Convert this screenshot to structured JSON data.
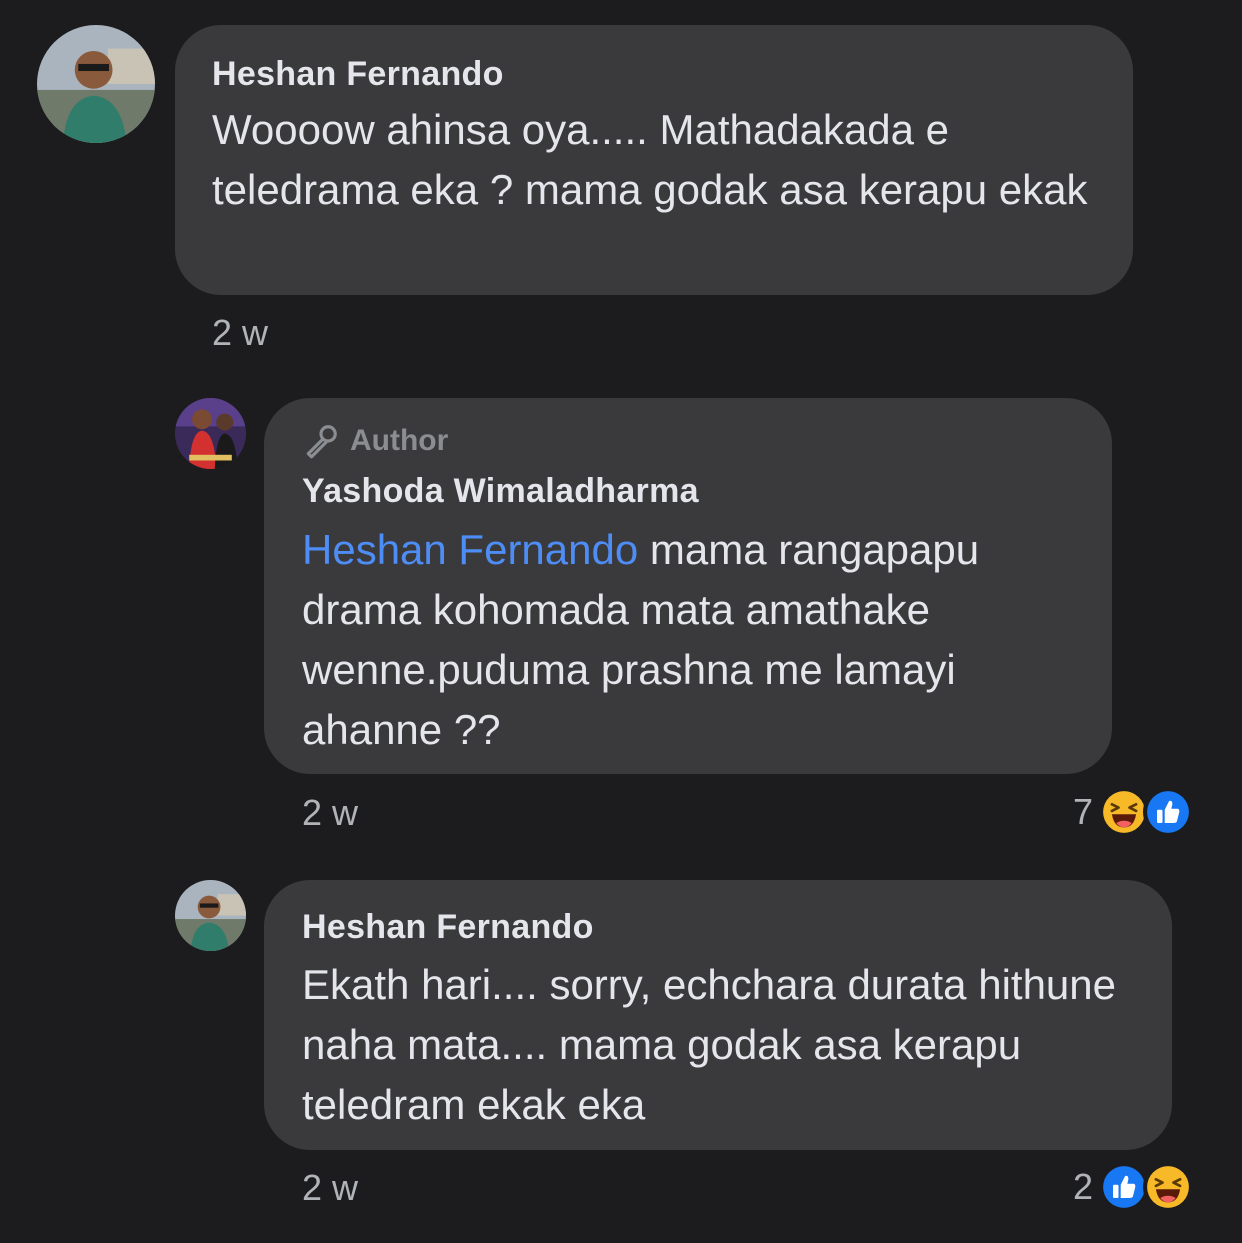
{
  "comments": [
    {
      "author": "Heshan Fernando",
      "text": "Woooow ahinsa oya..... Mathadakada e teledrama eka ? mama godak asa kerapu ekak",
      "time": "2 w"
    },
    {
      "badge": "Author",
      "author": "Yashoda Wimaladharma",
      "mention": "Heshan Fernando",
      "text": " mama rangapapu drama kohomada mata amathake wenne.puduma prashna me lamayi ahanne ??",
      "time": "2 w",
      "reaction_count": "7",
      "reactions": [
        "haha-icon",
        "like-icon"
      ]
    },
    {
      "author": "Heshan Fernando",
      "text": "Ekath hari.... sorry, echchara durata hithune naha mata.... mama godak asa kerapu teledram ekak eka",
      "time": "2 w",
      "reaction_count": "2",
      "reactions": [
        "like-icon",
        "haha-icon"
      ]
    }
  ],
  "colors": {
    "background": "#1c1c1e",
    "bubble": "#3a3a3c",
    "mention": "#4e8df5",
    "like": "#1877f2",
    "haha": "#f7b928"
  }
}
